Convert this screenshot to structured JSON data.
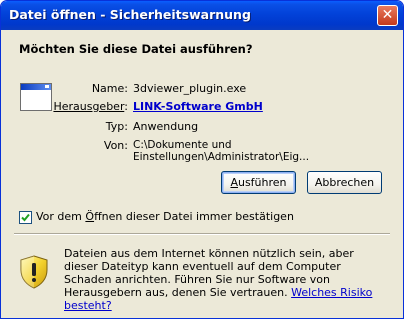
{
  "window": {
    "title": "Datei öffnen - Sicherheitswarnung",
    "close_glyph": "✕"
  },
  "question": "Möchten Sie diese Datei ausführen?",
  "file": {
    "name_label": "Name:",
    "name_value": "3dviewer_plugin.exe",
    "publisher_label_prefix": "Herausgeber",
    "publisher_label_suffix": ":",
    "publisher_value": "LINK-Software GmbH",
    "type_label": "Typ:",
    "type_value": "Anwendung",
    "from_label": "Von:",
    "from_value": "C:\\Dokumente und Einstellungen\\Administrator\\Eig..."
  },
  "buttons": {
    "run_accel": "A",
    "run_rest": "usführen",
    "cancel": "Abbrechen"
  },
  "checkbox": {
    "checked": true,
    "label_prefix": "Vor dem ",
    "label_accel": "Ö",
    "label_rest": "ffnen dieser Datei immer bestätigen"
  },
  "warning": {
    "text": "Dateien aus dem Internet können nützlich sein, aber dieser Dateityp kann eventuell auf dem Computer Schaden anrichten. Führen Sie nur Software von Herausgebern aus, denen Sie vertrauen. ",
    "link": "Welches Risiko besteht?"
  },
  "colors": {
    "title_bar": "#0242d9",
    "dialog_bg": "#ece9d8",
    "link": "#0000cc"
  },
  "icons": {
    "app": "application-window-icon",
    "warning": "security-shield-warning-icon",
    "checkmark": "checkmark-icon"
  }
}
